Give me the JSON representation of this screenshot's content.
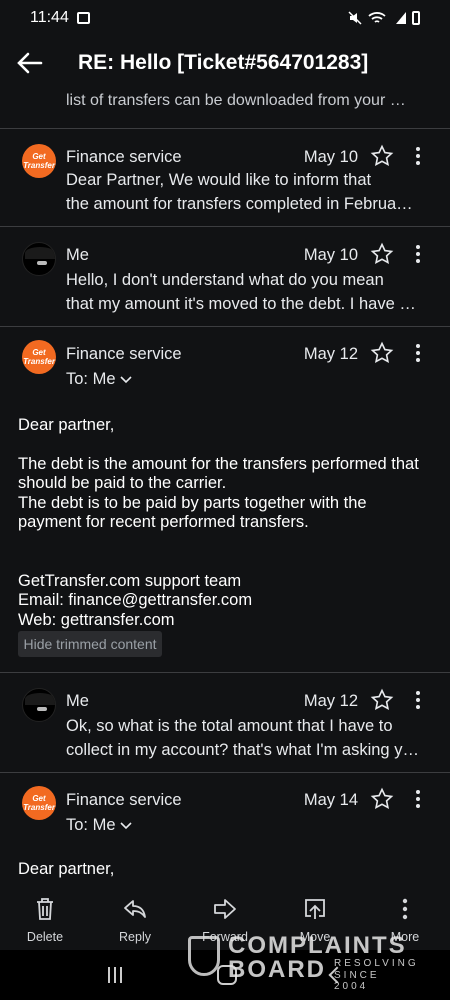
{
  "status_bar": {
    "time": "11:44"
  },
  "header": {
    "subject": "RE: Hello [Ticket#564701283]"
  },
  "top_snippet": "list of transfers can be downloaded from your …",
  "messages": [
    {
      "sender": "Finance service",
      "date": "May 10",
      "avatar_text": [
        "Get",
        "Transfer"
      ],
      "line1": "Dear Partner, We would like to inform that",
      "line2": "the amount for transfers completed in Februa…"
    },
    {
      "sender": "Me",
      "date": "May 10",
      "line1": "Hello, I don't understand what do you mean",
      "line2": "that my amount it's moved to the debt. I have …"
    },
    {
      "sender": "Finance service",
      "date": "May 12",
      "avatar_text": [
        "Get",
        "Transfer"
      ],
      "to": "To: Me",
      "body": {
        "greeting": "Dear partner,",
        "p1_l1": "The debt is the amount for the transfers performed that",
        "p1_l2": "should be paid to the carrier.",
        "p1_l3": "The debt is to be paid by parts together with the",
        "p1_l4": "payment for recent performed transfers.",
        "sig1": "GetTransfer.com support team",
        "sig2": "Email: finance@gettransfer.com",
        "sig3": "Web: gettransfer.com"
      },
      "trim_label": "Hide trimmed content"
    },
    {
      "sender": "Me",
      "date": "May 12",
      "line1": "Ok, so what is the total amount that I have to",
      "line2": "collect in my account? that's what I'm asking y…"
    },
    {
      "sender": "Finance service",
      "date": "May 14",
      "avatar_text": [
        "Get",
        "Transfer"
      ],
      "to": "To: Me",
      "greeting": "Dear partner,"
    }
  ],
  "bottom_actions": [
    {
      "label": "Delete",
      "icon": "trash-icon"
    },
    {
      "label": "Reply",
      "icon": "reply-icon"
    },
    {
      "label": "Forward",
      "icon": "forward-icon"
    },
    {
      "label": "Move",
      "icon": "move-icon"
    },
    {
      "label": "More",
      "icon": "more-vertical-icon"
    }
  ],
  "watermark": {
    "line1": "COMPLAINTS",
    "line2": "BOARD",
    "sub1": "RESOLVING",
    "sub2": "SINCE 2004"
  },
  "colors": {
    "background": "#111214",
    "avatar_orange": "#f26a21",
    "divider": "#3c3d40"
  }
}
